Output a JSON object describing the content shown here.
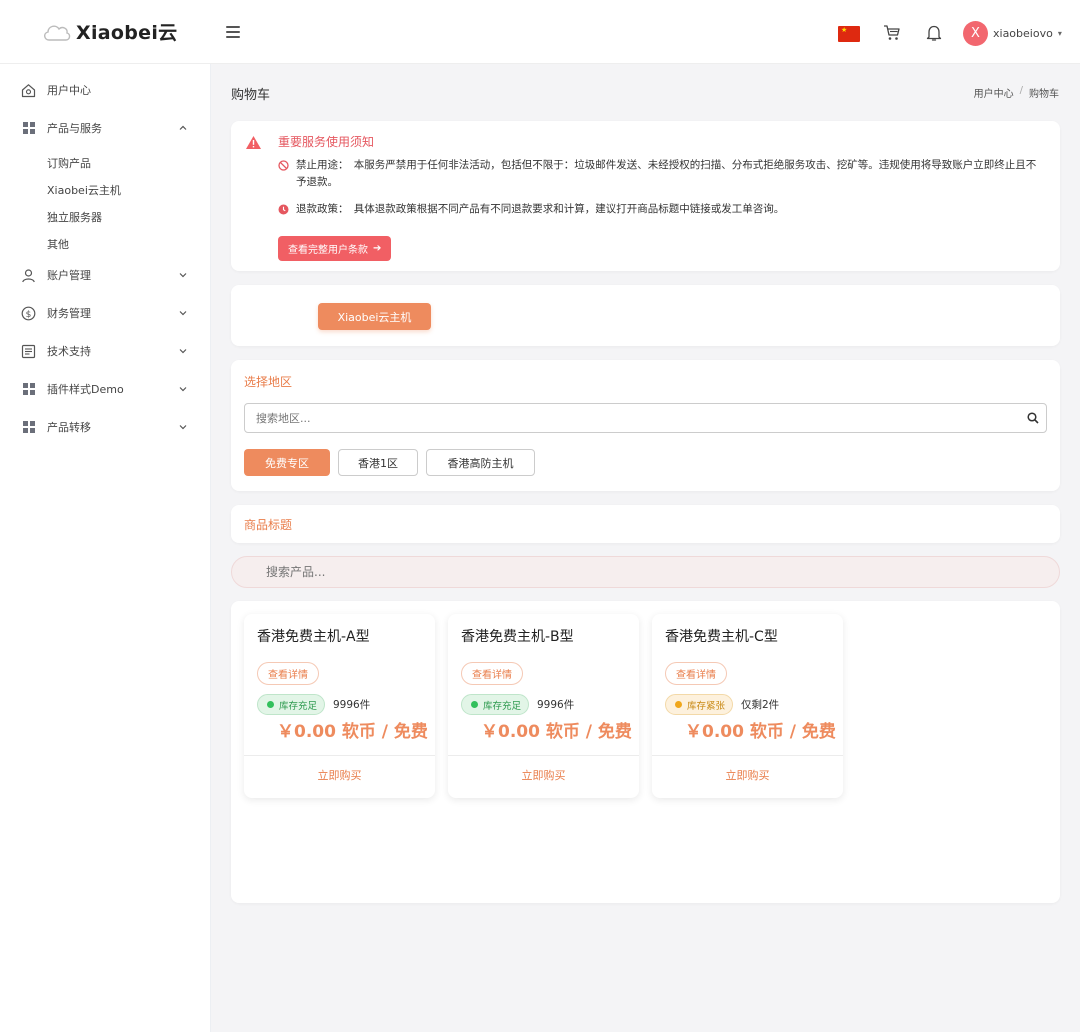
{
  "header": {
    "logo_text": "Xiaobei云",
    "user_initial": "X",
    "user_name": "xiaobeiovo",
    "flag_label": "China flag"
  },
  "sidebar": {
    "items": [
      {
        "label": "用户中心",
        "icon": "home-icon"
      },
      {
        "label": "产品与服务",
        "icon": "grid-icon",
        "expanded": true,
        "children": [
          "订购产品",
          "Xiaobei云主机",
          "独立服务器",
          "其他"
        ]
      },
      {
        "label": "账户管理",
        "icon": "user-icon"
      },
      {
        "label": "财务管理",
        "icon": "dollar-icon"
      },
      {
        "label": "技术支持",
        "icon": "document-icon"
      },
      {
        "label": "插件样式Demo",
        "icon": "grid-icon"
      },
      {
        "label": "产品转移",
        "icon": "grid-icon"
      }
    ]
  },
  "page": {
    "title": "购物车",
    "breadcrumb": [
      "用户中心",
      "购物车"
    ]
  },
  "notice": {
    "title": "重要服务使用须知",
    "prohibited": "禁止用途：　本服务严禁用于任何非法活动，包括但不限于：垃圾邮件发送、未经授权的扫描、分布式拒绝服务攻击、挖矿等。违规使用将导致账户立即终止且不予退款。",
    "refund": "退款政策：　具体退款政策根据不同产品有不同退款要求和计算，建议打开商品标题中链接或发工单咨询。",
    "button": "查看完整用户条款"
  },
  "category": {
    "button": "Xiaobei云主机"
  },
  "region": {
    "label": "选择地区",
    "search_placeholder": "搜索地区...",
    "buttons": [
      "免费专区",
      "香港1区",
      "香港高防主机"
    ],
    "active": "免费专区"
  },
  "product_section": {
    "label": "商品标题",
    "search_placeholder": "搜索产品..."
  },
  "products": [
    {
      "name": "香港免费主机-A型",
      "detail": "查看详情",
      "stock_label": "库存充足",
      "stock_status": "ok",
      "count": "9996件",
      "price": "￥0.00 软币 / 免费",
      "buy": "立即购买"
    },
    {
      "name": "香港免费主机-B型",
      "detail": "查看详情",
      "stock_label": "库存充足",
      "stock_status": "ok",
      "count": "9996件",
      "price": "￥0.00 软币 / 免费",
      "buy": "立即购买"
    },
    {
      "name": "香港免费主机-C型",
      "detail": "查看详情",
      "stock_label": "库存紧张",
      "stock_status": "low",
      "count": "仅剩2件",
      "price": "￥0.00 软币 / 免费",
      "buy": "立即购买"
    }
  ],
  "colors": {
    "accent": "#ee8b5e",
    "danger": "#f15f64",
    "stock_ok": "#32c05c",
    "stock_low": "#f0a71c"
  }
}
